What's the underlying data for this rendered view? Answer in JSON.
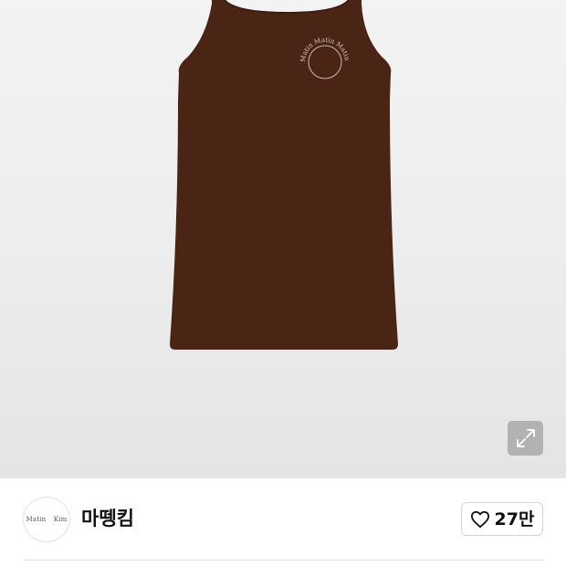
{
  "product": {
    "image_alt": "brown sleeveless tank dress with circular Matin Kim logo",
    "logo_print_text": "Matin Matin Matin",
    "garment_color": "#4a2516"
  },
  "brand": {
    "logo_text": "Matin Kim",
    "name": "마뗑킴",
    "like_count": "27만"
  },
  "icons": {
    "expand": "expand-arrows-icon",
    "heart": "heart-outline-icon"
  }
}
